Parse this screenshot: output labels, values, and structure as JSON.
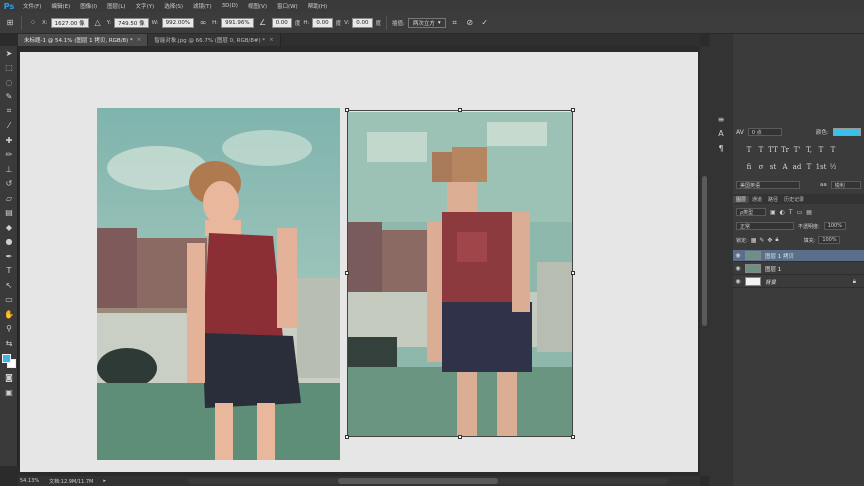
{
  "app": {
    "logo": "Ps"
  },
  "menu": [
    "文件(F)",
    "编辑(E)",
    "图像(I)",
    "图层(L)",
    "文字(Y)",
    "选择(S)",
    "滤镜(T)",
    "3D(D)",
    "视图(V)",
    "窗口(W)",
    "帮助(H)"
  ],
  "options": {
    "x_label": "X:",
    "x_value": "1627.00 像",
    "y_label": "Y:",
    "y_value": "749.50 像",
    "w_label": "W:",
    "w_value": "992.00%",
    "h_label": "H:",
    "h_value": "991.96%",
    "angle_value": "0.00",
    "angle_unit": "度",
    "hskew_label": "H:",
    "hskew_value": "0.00",
    "hskew_unit": "度",
    "vskew_label": "V:",
    "vskew_value": "0.00",
    "vskew_unit": "度",
    "interp_label": "插值:",
    "interp_value": "两次立方"
  },
  "tabs": [
    {
      "label": "未标题-1 @ 54.1% (图层 1 拷贝, RGB/8) *"
    },
    {
      "label": "智能对象.jpg @ 66.7% (图层 0, RGB/8#) *"
    }
  ],
  "colors": {
    "foreground": "#3bb6e6",
    "background": "#ffffff",
    "accent": "#2fa0e8"
  },
  "status": {
    "zoom": "54.13%",
    "doc": "文档:12.9M/11.7M"
  },
  "character_panel": {
    "tracking_value": "0 点",
    "color_label": "颜色:",
    "color_value": "#3bc0ea",
    "style_buttons": [
      "T",
      "T",
      "TT",
      "Tr",
      "T'",
      "T,",
      "T",
      "T"
    ],
    "format_buttons": [
      "fi",
      "σ",
      "st",
      "A",
      "ad",
      "T",
      "1st",
      "½"
    ],
    "language": "美国英语",
    "aa_label": "aa",
    "aa_value": "锐利"
  },
  "layers_panel": {
    "tabs": [
      "图层",
      "通道",
      "路径",
      "历史记录"
    ],
    "filter_label": "ρ类型",
    "blend_mode": "正常",
    "opacity_label": "不透明度:",
    "opacity_value": "100%",
    "lock_label": "锁定:",
    "fill_label": "填充:",
    "fill_value": "100%",
    "layers": [
      {
        "name": "图层 1 拷贝",
        "selected": true
      },
      {
        "name": "图层 1",
        "selected": false
      },
      {
        "name": "背景",
        "selected": false
      }
    ]
  }
}
